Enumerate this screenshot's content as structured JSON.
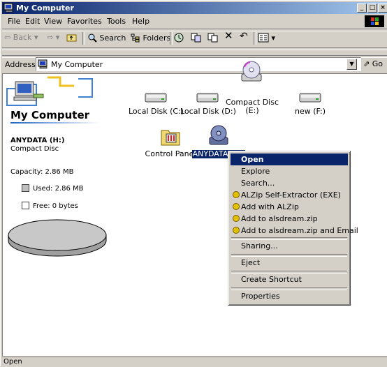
{
  "window": {
    "title": "My Computer"
  },
  "menu": [
    "File",
    "Edit",
    "View",
    "Favorites",
    "Tools",
    "Help"
  ],
  "toolbar": {
    "back": "Back",
    "search": "Search",
    "folders": "Folders"
  },
  "address": {
    "label": "Address",
    "value": "My Computer",
    "go": "Go"
  },
  "left_panel": {
    "heading": "My Computer",
    "drive_name": "ANYDATA (H:)",
    "drive_type": "Compact Disc",
    "capacity": "Capacity: 2.86 MB",
    "used": "Used: 2.86 MB",
    "free": "Free: 0 bytes",
    "used_fraction": 1.0
  },
  "icons": [
    {
      "label": "Local Disk (C:)",
      "icon": "hard-disk-icon"
    },
    {
      "label": "Local Disk (D:)",
      "icon": "hard-disk-icon"
    },
    {
      "label": "Compact Disc (E:)",
      "icon": "cd-drive-icon"
    },
    {
      "label": "new (F:)",
      "icon": "hard-disk-icon"
    },
    {
      "label": "Control Panel",
      "icon": "control-panel-icon"
    },
    {
      "label": "ANYDATA (H:)",
      "icon": "cd-drive-icon",
      "selected": true
    }
  ],
  "context_menu": {
    "items": [
      "Open",
      "Explore",
      "Search...",
      "ALZip Self-Extractor (EXE)",
      "Add with ALZip",
      "Add to alsdream.zip",
      "Add to alsdream.zip and Email",
      "Sharing...",
      "Eject",
      "Create Shortcut",
      "Properties"
    ]
  },
  "status": {
    "text": "Open"
  },
  "colors": {
    "titlebar": "#0a246a",
    "face": "#d4d0c8",
    "highlight": "#0a246a"
  }
}
